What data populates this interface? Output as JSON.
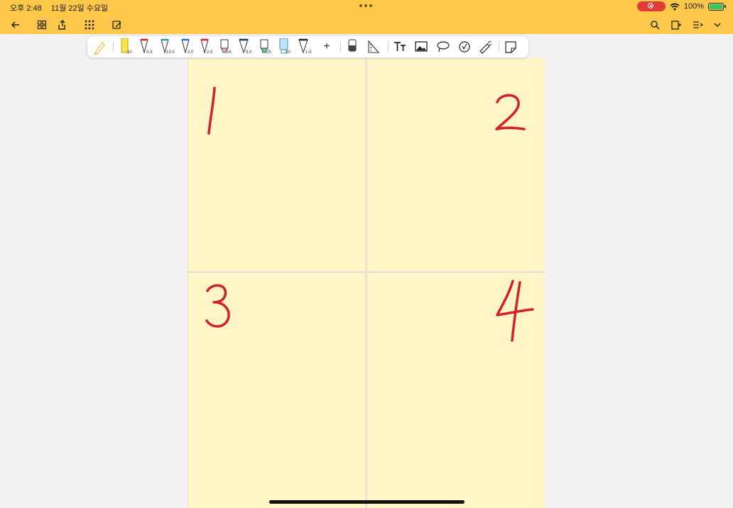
{
  "status_bar": {
    "time": "오후 2:48",
    "date": "11월 22일 수요일",
    "battery": "100%",
    "wifi_icon": "wifi-icon",
    "recording_icon": "screen-record-icon"
  },
  "nav_left": [
    "back-arrow-icon",
    "grid-view-icon",
    "share-upload-icon",
    "apps-icon",
    "edit-page-icon"
  ],
  "nav_right": [
    "search-icon",
    "add-page-icon",
    "more-menu-icon",
    "chevron-down-icon"
  ],
  "toolbar": {
    "tools": [
      {
        "name": "pencil-tool",
        "size": ""
      },
      {
        "name": "highlighter-yellow",
        "size": "10"
      },
      {
        "name": "pen-red",
        "size": "4.3"
      },
      {
        "name": "pen-teal",
        "size": "13.0"
      },
      {
        "name": "pen-blue",
        "size": "2.0"
      },
      {
        "name": "pen-red-2",
        "size": "2.0"
      },
      {
        "name": "pen-pink",
        "size": "16"
      },
      {
        "name": "pen-navy",
        "size": "5.0"
      },
      {
        "name": "pen-green",
        "size": "25"
      },
      {
        "name": "marker-lightblue",
        "size": "30"
      },
      {
        "name": "pen-black",
        "size": "1.0"
      }
    ],
    "add_label": "+",
    "right_tools": [
      "eraser-icon",
      "ruler-icon",
      "text-icon",
      "image-icon",
      "lasso-icon",
      "sticker-icon",
      "laser-pointer-icon",
      "sticky-note-icon"
    ]
  },
  "colors": {
    "accent": "#fdc74a",
    "page": "#fff5c7",
    "ink": "#d42027"
  },
  "quadrants": [
    {
      "label": "1"
    },
    {
      "label": "2"
    },
    {
      "label": "3"
    },
    {
      "label": "4"
    }
  ]
}
